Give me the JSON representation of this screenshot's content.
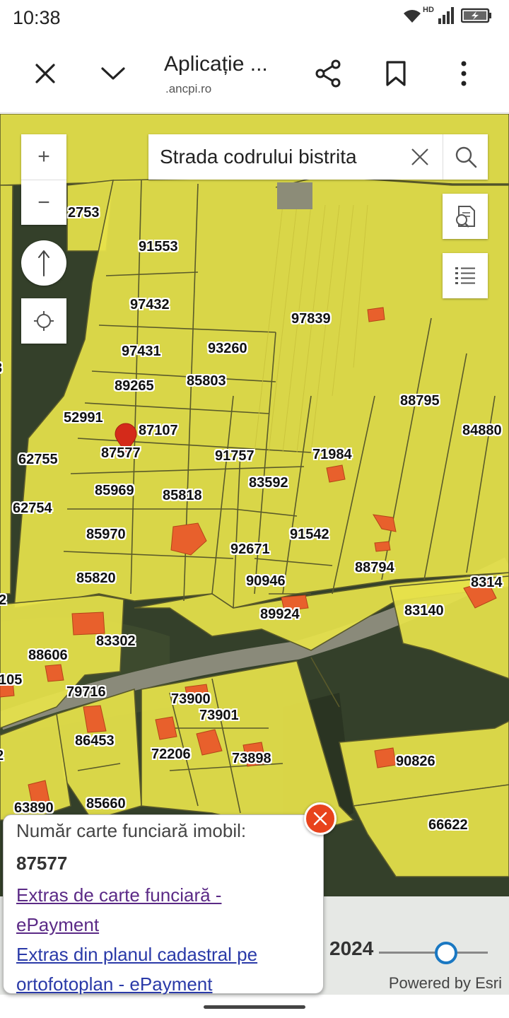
{
  "status_bar": {
    "time": "10:38",
    "network": "HD",
    "icons": [
      "wifi-icon",
      "cellular-signal-icon",
      "battery-charging-icon"
    ]
  },
  "browser": {
    "title": "Aplicație ...",
    "url": ".ancpi.ro",
    "icons": [
      "close-icon",
      "chevron-down-icon",
      "share-icon",
      "bookmark-icon",
      "more-vertical-icon"
    ]
  },
  "map": {
    "search": {
      "value": "Strada codrului bistrita",
      "placeholder": ""
    },
    "controls": [
      "zoom-in-icon",
      "zoom-out-icon",
      "compass-north-icon",
      "locate-icon",
      "identify-search-icon",
      "legend-list-icon"
    ],
    "zoom_in_label": "+",
    "zoom_out_label": "−",
    "parcel_labels": [
      "2753",
      "91553",
      "97432",
      "97839",
      "97431",
      "93260",
      "3",
      "89265",
      "85803",
      "88795",
      "52991",
      "87107",
      "84880",
      "87577",
      "62755",
      "91757",
      "71984",
      "83592",
      "85969",
      "85818",
      "62754",
      "85970",
      "91542",
      "92671",
      "88794",
      "85820",
      "90946",
      "8314",
      "2",
      "89924",
      "83140",
      "83302",
      "88606",
      "105",
      "79716",
      "73900",
      "73901",
      "86453",
      "72206",
      "73898",
      "2",
      "90826",
      "63890",
      "85660",
      "66622"
    ],
    "selected_parcel": "87577",
    "colors": {
      "parcel_fill": "#e6e24a",
      "parcel_outline": "#5a5a2a",
      "building": "#e8602c",
      "marker": "#d42a1a"
    }
  },
  "timeline": {
    "year": "2024",
    "slider_position_fraction": 0.62
  },
  "attribution": "Powered by Esri",
  "popup": {
    "heading": "Număr carte funciară imobil:",
    "number": "87577",
    "link1_line1": "Extras de carte funciară -",
    "link1_line2": "ePayment",
    "link2_line1": "Extras din planul cadastral pe",
    "link2_line2": "ortofotoplan - ePayment"
  }
}
